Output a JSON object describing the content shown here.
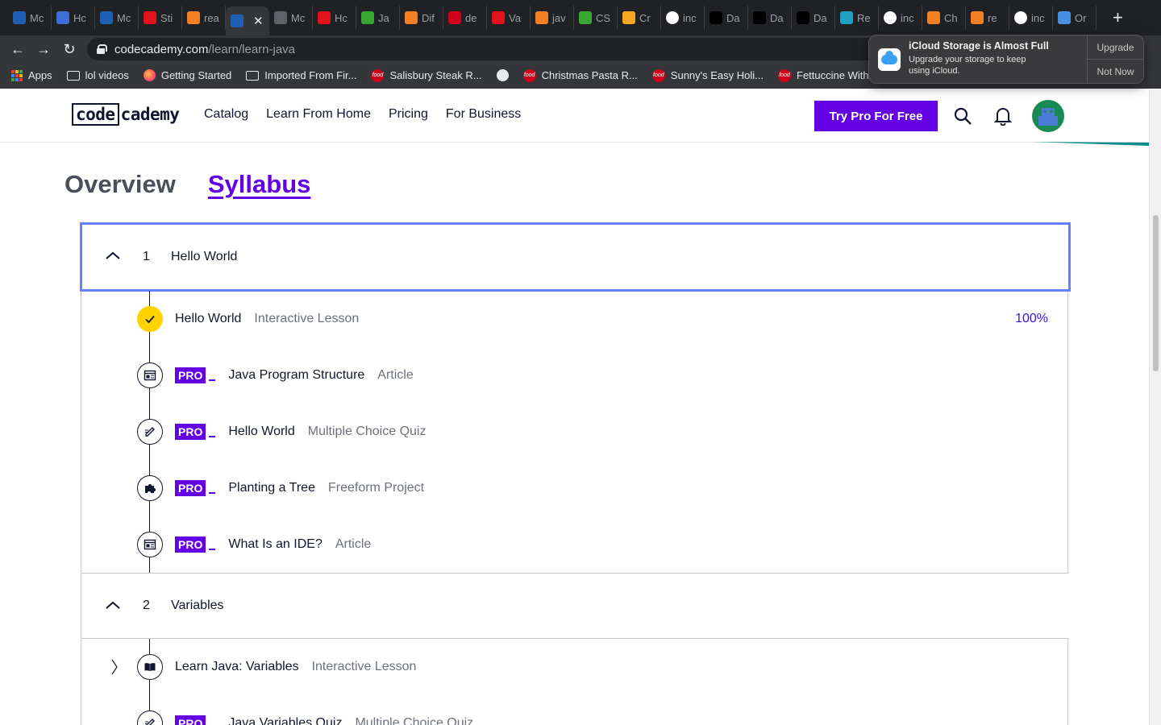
{
  "browser": {
    "tabs": [
      {
        "label": "Mc",
        "fav_color": "#1f5fb4"
      },
      {
        "label": "Hc",
        "fav_color": "#3d6fd4"
      },
      {
        "label": "Mc",
        "fav_color": "#1f5fb4"
      },
      {
        "label": "Sti",
        "fav_color": "#e2131a"
      },
      {
        "label": "rea",
        "fav_color": "#f48024"
      },
      {
        "label": "",
        "fav_color": "#1f5fb4",
        "active": true
      },
      {
        "label": "Mc",
        "fav_color": "#5f6368"
      },
      {
        "label": "Hc",
        "fav_color": "#e2131a"
      },
      {
        "label": "Ja",
        "fav_color": "#38a832"
      },
      {
        "label": "Dif",
        "fav_color": "#f48024"
      },
      {
        "label": "de",
        "fav_color": "#d0021b"
      },
      {
        "label": "Va",
        "fav_color": "#e2131a"
      },
      {
        "label": "jav",
        "fav_color": "#f48024"
      },
      {
        "label": "CS",
        "fav_color": "#38a832"
      },
      {
        "label": "Cr",
        "fav_color": "#f5a623"
      },
      {
        "label": "inc",
        "fav_color": "#ffffff"
      },
      {
        "label": "Da",
        "fav_color": "#000000"
      },
      {
        "label": "Da",
        "fav_color": "#000000"
      },
      {
        "label": "Da",
        "fav_color": "#000000"
      },
      {
        "label": "Re",
        "fav_color": "#21a0c4"
      },
      {
        "label": "inc",
        "fav_color": "#ffffff"
      },
      {
        "label": "Ch",
        "fav_color": "#f48024"
      },
      {
        "label": "re",
        "fav_color": "#f48024"
      },
      {
        "label": "inc",
        "fav_color": "#ffffff"
      },
      {
        "label": "Or",
        "fav_color": "#4a90e2"
      }
    ],
    "url_host": "codecademy.com",
    "url_path": "/learn/learn-java",
    "bookmarks": [
      {
        "label": "Apps",
        "icon": "apps-grid-icon"
      },
      {
        "label": "lol videos",
        "icon": "folder-icon"
      },
      {
        "label": "Getting Started",
        "icon": "firefox-icon"
      },
      {
        "label": "Imported From Fir...",
        "icon": "folder-icon"
      },
      {
        "label": "Salisbury Steak R...",
        "icon": "food-icon"
      },
      {
        "label": "",
        "icon": "globe-icon"
      },
      {
        "label": "Christmas Pasta R...",
        "icon": "food-icon"
      },
      {
        "label": "Sunny's Easy Holi...",
        "icon": "food-icon"
      },
      {
        "label": "Fettuccine With C",
        "icon": "food-icon"
      }
    ]
  },
  "notification": {
    "title": "iCloud Storage is Almost Full",
    "body": "Upgrade your storage to keep using iCloud.",
    "upgrade": "Upgrade",
    "not_now": "Not Now"
  },
  "header": {
    "logo_box": "code",
    "logo_rest": "cademy",
    "nav": [
      "Catalog",
      "Learn From Home",
      "Pricing",
      "For Business"
    ],
    "cta": "Try Pro For Free"
  },
  "page_tabs": {
    "overview": "Overview",
    "syllabus": "Syllabus"
  },
  "modules": [
    {
      "number": "1",
      "title": "Hello World",
      "items": [
        {
          "title": "Hello World",
          "type": "Interactive Lesson",
          "pro": false,
          "done": true,
          "progress": "100%",
          "icon": "check-icon"
        },
        {
          "title": "Java Program Structure",
          "type": "Article",
          "pro": true,
          "icon": "article-icon"
        },
        {
          "title": "Hello World",
          "type": "Multiple Choice Quiz",
          "pro": true,
          "icon": "quiz-pencil-icon"
        },
        {
          "title": "Planting a Tree",
          "type": "Freeform Project",
          "pro": true,
          "icon": "puzzle-icon"
        },
        {
          "title": "What Is an IDE?",
          "type": "Article",
          "pro": true,
          "icon": "article-icon"
        }
      ]
    },
    {
      "number": "2",
      "title": "Variables",
      "items": [
        {
          "title": "Learn Java: Variables",
          "type": "Interactive Lesson",
          "pro": false,
          "icon": "book-icon"
        },
        {
          "title": "Java Variables Quiz",
          "type": "Multiple Choice Quiz",
          "pro": true,
          "icon": "quiz-pencil-icon"
        }
      ]
    }
  ],
  "pro_label": "PRO",
  "colors": {
    "brand_purple": "#6400e4",
    "done_yellow": "#ffd300",
    "focus_blue": "#6680ff",
    "percent_blue": "#3a10e5"
  }
}
